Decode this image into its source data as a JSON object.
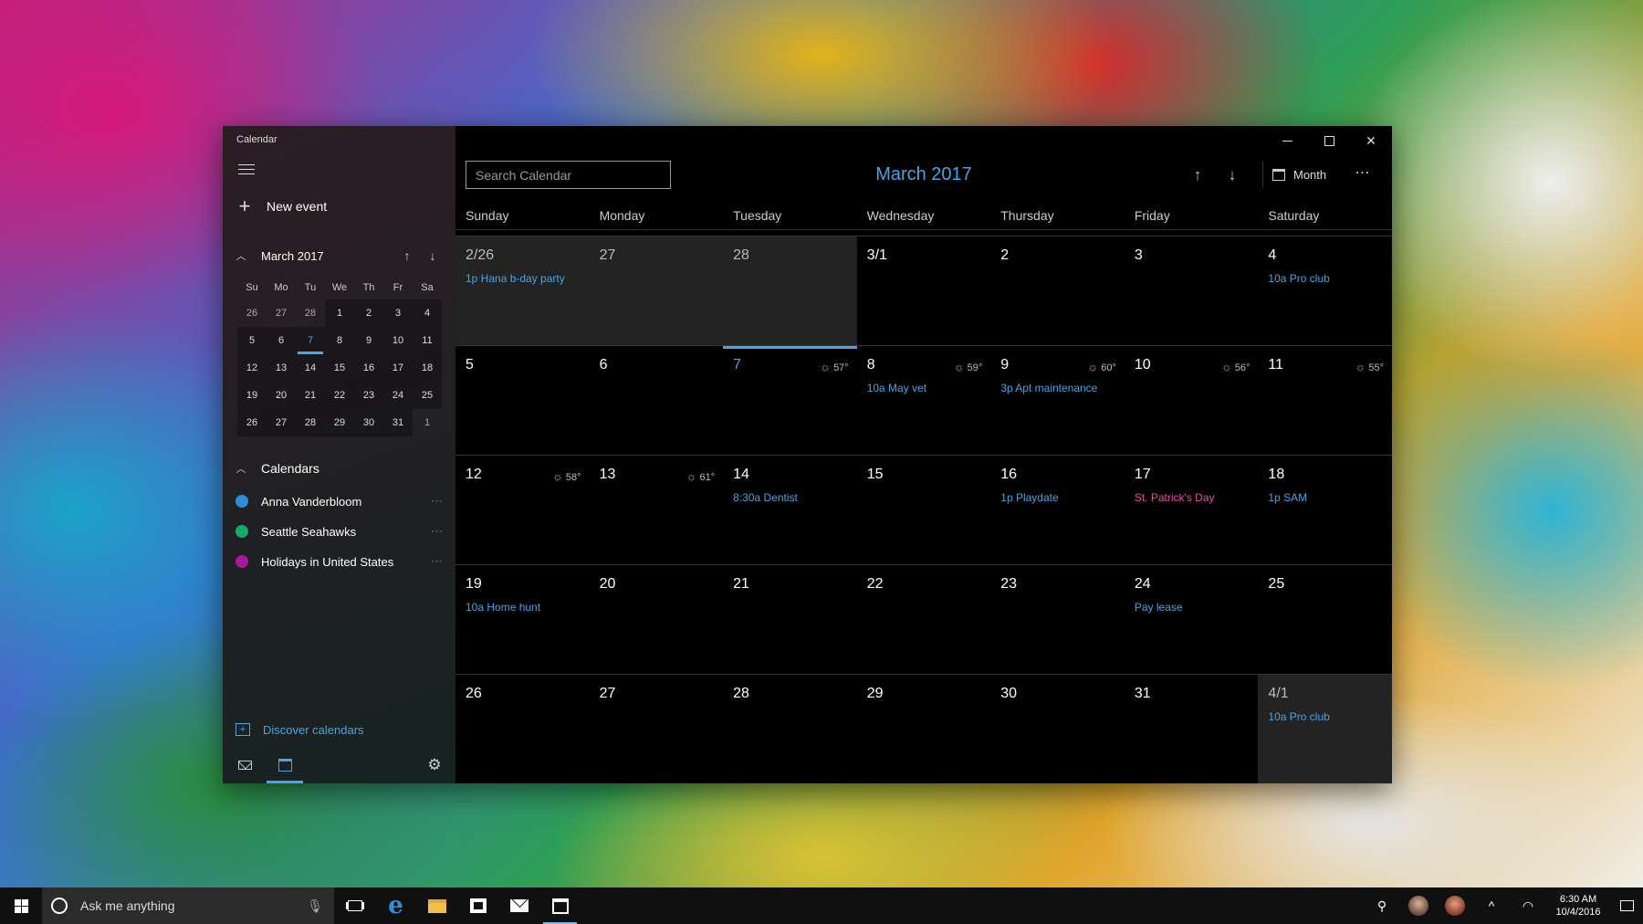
{
  "window": {
    "app_title": "Calendar"
  },
  "sidebar": {
    "new_event_label": "New event",
    "mini_calendar": {
      "title": "March 2017",
      "weekdays": [
        "Su",
        "Mo",
        "Tu",
        "We",
        "Th",
        "Fr",
        "Sa"
      ],
      "weeks": [
        [
          "26",
          "27",
          "28",
          "1",
          "2",
          "3",
          "4"
        ],
        [
          "5",
          "6",
          "7",
          "8",
          "9",
          "10",
          "11"
        ],
        [
          "12",
          "13",
          "14",
          "15",
          "16",
          "17",
          "18"
        ],
        [
          "19",
          "20",
          "21",
          "22",
          "23",
          "24",
          "25"
        ],
        [
          "26",
          "27",
          "28",
          "29",
          "30",
          "31",
          "1"
        ]
      ],
      "today": "7"
    },
    "calendars_header": "Calendars",
    "calendars": [
      {
        "name": "Anna Vanderbloom",
        "color": "#2a8fd6"
      },
      {
        "name": "Seattle Seahawks",
        "color": "#17a86b"
      },
      {
        "name": "Holidays in United States",
        "color": "#a8179c"
      }
    ],
    "discover_label": "Discover calendars"
  },
  "toolbar": {
    "search_placeholder": "Search Calendar",
    "month_title": "March 2017",
    "view_label": "Month"
  },
  "grid": {
    "weekdays": [
      "Sunday",
      "Monday",
      "Tuesday",
      "Wednesday",
      "Thursday",
      "Friday",
      "Saturday"
    ],
    "weeks": [
      [
        {
          "day": "2/26",
          "other": true,
          "events": [
            "1p Hana b-day party"
          ]
        },
        {
          "day": "27",
          "other": true,
          "events": []
        },
        {
          "day": "28",
          "other": true,
          "events": []
        },
        {
          "day": "3/1",
          "events": []
        },
        {
          "day": "2",
          "events": []
        },
        {
          "day": "3",
          "events": []
        },
        {
          "day": "4",
          "events": [
            "10a Pro club"
          ]
        }
      ],
      [
        {
          "day": "5",
          "events": []
        },
        {
          "day": "6",
          "events": []
        },
        {
          "day": "7",
          "today": true,
          "weather": "57°",
          "events": []
        },
        {
          "day": "8",
          "weather": "59°",
          "events": [
            "10a May vet"
          ]
        },
        {
          "day": "9",
          "weather": "60°",
          "events": [
            "3p Apt maintenance"
          ]
        },
        {
          "day": "10",
          "weather": "56°",
          "events": []
        },
        {
          "day": "11",
          "weather": "55°",
          "events": []
        }
      ],
      [
        {
          "day": "12",
          "weather": "58°",
          "events": []
        },
        {
          "day": "13",
          "weather": "61°",
          "events": []
        },
        {
          "day": "14",
          "events": [
            "8:30a Dentist"
          ]
        },
        {
          "day": "15",
          "events": []
        },
        {
          "day": "16",
          "events": [
            "1p Playdate"
          ]
        },
        {
          "day": "17",
          "events": [
            "St. Patrick's Day"
          ],
          "holiday": true
        },
        {
          "day": "18",
          "events": [
            "1p SAM"
          ]
        }
      ],
      [
        {
          "day": "19",
          "events": [
            "10a Home hunt"
          ]
        },
        {
          "day": "20",
          "events": []
        },
        {
          "day": "21",
          "events": []
        },
        {
          "day": "22",
          "events": []
        },
        {
          "day": "23",
          "events": []
        },
        {
          "day": "24",
          "events": [
            "Pay lease"
          ]
        },
        {
          "day": "25",
          "events": []
        }
      ],
      [
        {
          "day": "26",
          "events": []
        },
        {
          "day": "27",
          "events": []
        },
        {
          "day": "28",
          "events": []
        },
        {
          "day": "29",
          "events": []
        },
        {
          "day": "30",
          "events": []
        },
        {
          "day": "31",
          "events": []
        },
        {
          "day": "4/1",
          "other": true,
          "events": [
            "10a Pro club"
          ]
        }
      ]
    ]
  },
  "taskbar": {
    "search_placeholder": "Ask me anything",
    "time": "6:30 AM",
    "date": "10/4/2016"
  },
  "colors": {
    "accent": "#4aa3e3",
    "holiday": "#e44ea8"
  }
}
